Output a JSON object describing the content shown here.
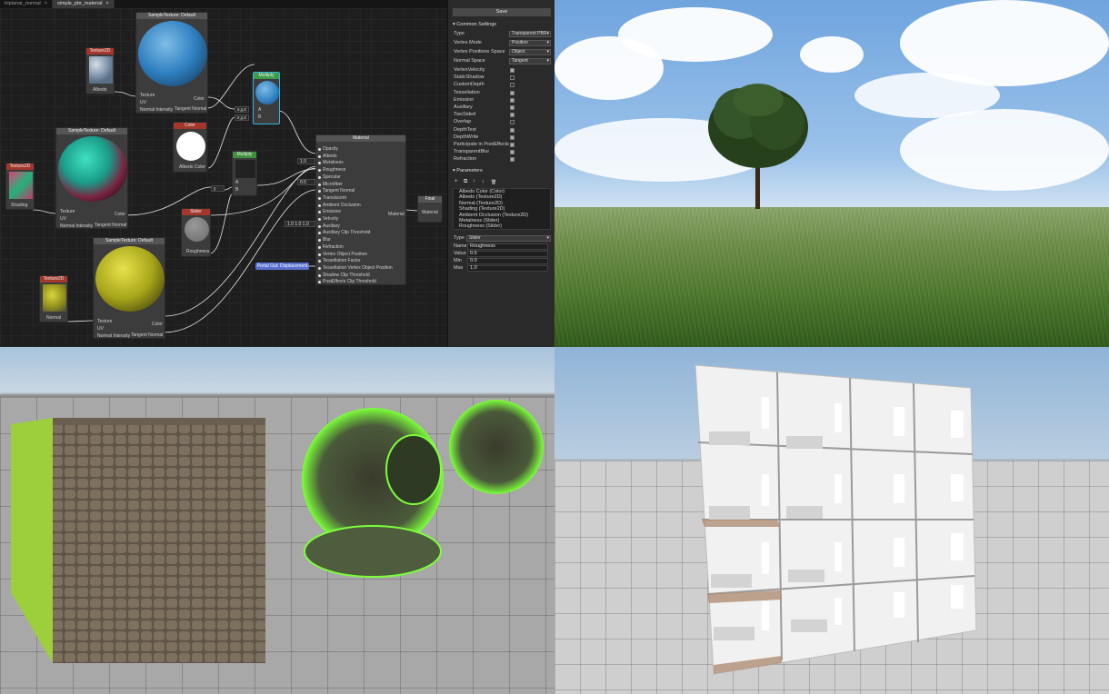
{
  "tabs": [
    {
      "label": "triplanar_normal",
      "close": "×"
    },
    {
      "label": "simple_pbr_material",
      "close": "×"
    }
  ],
  "nodes": {
    "sample_top": {
      "title": "SampleTexture: Default",
      "inputs": [
        "Texture",
        "UV",
        "Normal Intensity"
      ],
      "outputs": [
        "Color",
        "Tangent Normal"
      ]
    },
    "sample_mid": {
      "title": "SampleTexture: Default",
      "inputs": [
        "Texture",
        "UV",
        "Normal Intensity"
      ],
      "outputs": [
        "Color",
        "Tangent Normal"
      ]
    },
    "sample_bot": {
      "title": "SampleTexture: Default",
      "inputs": [
        "Texture",
        "UV",
        "Normal Intensity"
      ],
      "outputs": [
        "Color",
        "Tangent Normal"
      ]
    },
    "tex_albedo": {
      "title": "Texture2D",
      "label": "Albedo"
    },
    "tex_shading": {
      "title": "Texture2D",
      "label": "Shading"
    },
    "tex_normal": {
      "title": "Texture2D",
      "label": "Normal"
    },
    "color": {
      "title": "Color",
      "label": "Albedo Color"
    },
    "multiply1": {
      "title": "Multiply",
      "a": "A",
      "b": "B",
      "xyz1": "x,y,z",
      "xyz2": "x,y,z"
    },
    "multiply2": {
      "title": "Multiply",
      "a": "A",
      "b": "B",
      "y": "y"
    },
    "slider": {
      "title": "Slider",
      "label": "Roughness"
    },
    "final": {
      "title": "Final",
      "input": "Material"
    },
    "portal": {
      "label": "Portal Out: Displacement"
    },
    "material": {
      "title": "Material",
      "output": "Material",
      "values": {
        "metalness": "1.0",
        "microfiber": "0.5",
        "auxiliary": "1.0 1.0 1.0"
      },
      "inputs": [
        "Opacity",
        "Albedo",
        "Metalness",
        "Roughness",
        "Specular",
        "Microfiber",
        "Tangent Normal",
        "Translucent",
        "Ambient Occlusion",
        "Emissive",
        "Velocity",
        "Auxiliary",
        "Auxiliary Clip Threshold",
        "Blur",
        "Refraction",
        "Vertex Object Position",
        "Tessellation Factor",
        "Tessellation Vertex Object Position",
        "Shadow Clip Threshold",
        "PostEffects Clip Threshold"
      ]
    }
  },
  "panel": {
    "save_label": "Save",
    "common_header": "▾ Common Settings",
    "selects": [
      {
        "label": "Type",
        "value": "Transparent PBR"
      },
      {
        "label": "Vertex Mode",
        "value": "Position"
      },
      {
        "label": "Vertex Positions Space",
        "value": "Object"
      },
      {
        "label": "Normal Space",
        "value": "Tangent"
      }
    ],
    "checks": [
      {
        "label": "VertexVelocity",
        "on": true
      },
      {
        "label": "StaticShadow",
        "on": false
      },
      {
        "label": "CustomDepth",
        "on": false
      },
      {
        "label": "Tessellation",
        "on": true
      },
      {
        "label": "Emission",
        "on": true
      },
      {
        "label": "Auxiliary",
        "on": true
      },
      {
        "label": "TwoSided",
        "on": true
      },
      {
        "label": "Overlap",
        "on": false
      },
      {
        "label": "DepthTest",
        "on": true
      },
      {
        "label": "DepthWrite",
        "on": true
      },
      {
        "label": "Participate in PostEffects",
        "on": true
      },
      {
        "label": "TransparentBlur",
        "on": true
      },
      {
        "label": "Refraction",
        "on": true
      }
    ],
    "params_header": "▾ Parameters",
    "tools": [
      "+",
      "⧉",
      "↑",
      "↓",
      "🗑"
    ],
    "params": [
      "Albedo Color (Color)",
      "Albedo (Texture2D)",
      "Normal (Texture2D)",
      "Shading (Texture2D)",
      "Ambient Occlusion (Texture2D)",
      "Metalness (Slider)",
      "Roughness (Slider)"
    ],
    "props": {
      "type_label": "Type",
      "type_value": "Slider",
      "name_label": "Name",
      "name_value": "Roughness",
      "value_label": "Value",
      "value_value": "0.5",
      "min_label": "Min",
      "min_value": "0.0",
      "max_label": "Max",
      "max_value": "1.0"
    }
  },
  "colors": {
    "accent": "#3ab0e0",
    "node_red": "#a3372c",
    "node_green": "#3f8f3f",
    "emissive_green": "#7cff3a"
  }
}
